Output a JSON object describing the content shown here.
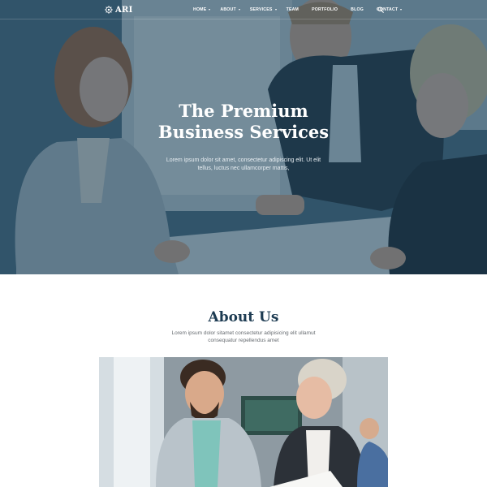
{
  "brand": {
    "name": "ARI",
    "icon": "gear-logo-icon"
  },
  "nav": {
    "items": [
      {
        "label": "HOME",
        "dropdown": true
      },
      {
        "label": "ABOUT",
        "dropdown": true
      },
      {
        "label": "SERVICES",
        "dropdown": true
      },
      {
        "label": "TEAM",
        "dropdown": false
      },
      {
        "label": "PORTFOLIO",
        "dropdown": false
      },
      {
        "label": "BLOG",
        "dropdown": false
      },
      {
        "label": "CONTACT",
        "dropdown": true
      }
    ],
    "search_icon": "search-icon"
  },
  "hero": {
    "title_line1": "The Premium",
    "title_line2": "Business Services",
    "subtitle": "Lorem ipsum dolor sit amet, consectetur adipiscing elit. Ut elit tellus, luctus nec ullamcorper mattis,"
  },
  "about": {
    "title": "About Us",
    "subtitle": "Lorem ipsum dolor sitamet consectetur adipisicing elit ullamut consequatur repellendus amet"
  },
  "colors": {
    "hero_overlay": "#1a4058",
    "heading": "#1d3b52",
    "body_text": "#666b70"
  }
}
